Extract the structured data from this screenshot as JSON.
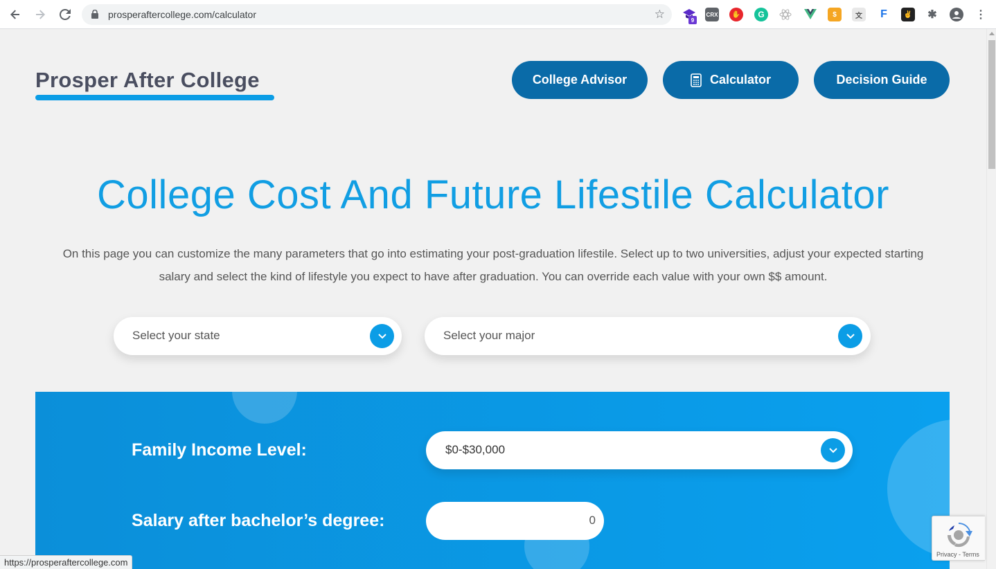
{
  "browser": {
    "url": "prosperaftercollege.com/calculator",
    "extension_badge": "9",
    "status_url": "https://prosperaftercollege.com"
  },
  "header": {
    "brand": "Prosper After College",
    "nav": [
      {
        "label": "College Advisor"
      },
      {
        "label": "Calculator"
      },
      {
        "label": "Decision Guide"
      }
    ]
  },
  "main": {
    "title": "College Cost And Future Lifestile Calculator",
    "intro": "On this page you can customize the many parameters that go into estimating your post-graduation lifestile. Select up to two universities, adjust your expected starting salary and select the kind of lifestyle you expect to have after graduation. You can override each value with your own $$ amount.",
    "state_select": {
      "placeholder": "Select your state"
    },
    "major_select": {
      "placeholder": "Select your major"
    }
  },
  "form": {
    "family_income_label": "Family Income Level:",
    "family_income_value": "$0-$30,000",
    "salary_label": "Salary after bachelor’s degree:",
    "salary_value": "0"
  },
  "recaptcha": {
    "legal": "Privacy - Terms"
  },
  "colors": {
    "accent": "#0b9de6",
    "nav_button": "#0a6ba8",
    "title": "#119ee3"
  }
}
